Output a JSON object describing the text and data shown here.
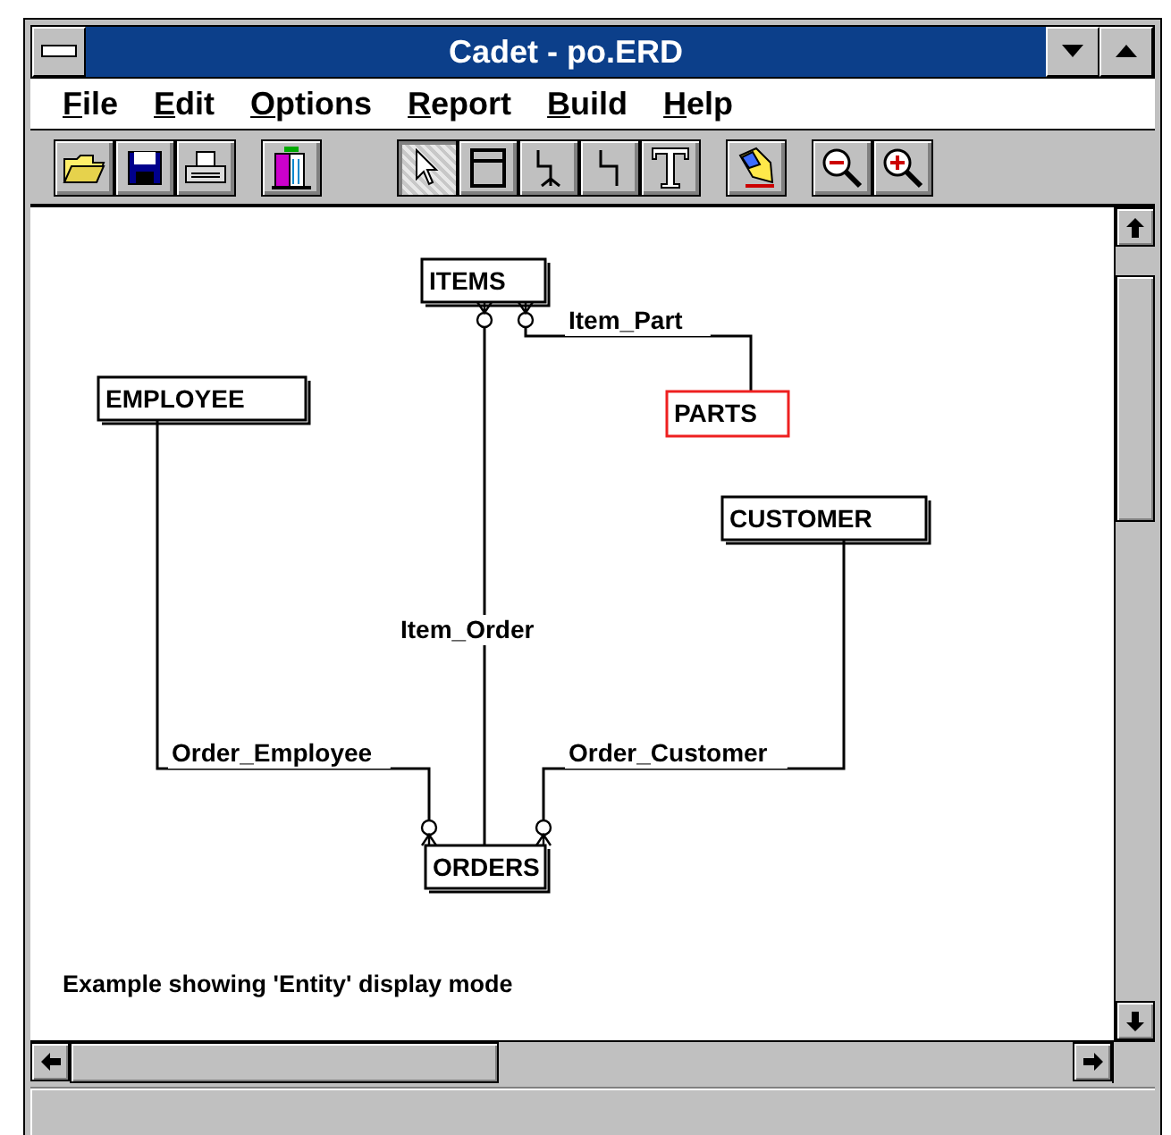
{
  "window": {
    "title": "Cadet - po.ERD"
  },
  "menu": [
    {
      "key": "F",
      "rest": "ile"
    },
    {
      "key": "E",
      "rest": "dit"
    },
    {
      "key": "O",
      "rest": "ptions"
    },
    {
      "key": "R",
      "rest": "eport"
    },
    {
      "key": "B",
      "rest": "uild"
    },
    {
      "key": "H",
      "rest": "elp"
    }
  ],
  "toolbar": [
    {
      "tools": [
        {
          "kind": "open"
        },
        {
          "kind": "save"
        },
        {
          "kind": "print"
        }
      ]
    },
    {
      "tools": [
        {
          "kind": "build"
        }
      ]
    },
    {
      "tools": [
        {
          "kind": "select",
          "selected": true
        },
        {
          "kind": "entity",
          "selected": false
        },
        {
          "kind": "branch",
          "selected": false
        },
        {
          "kind": "relation",
          "selected": false
        },
        {
          "kind": "text",
          "selected": false
        }
      ]
    },
    {
      "tools": [
        {
          "kind": "paint"
        }
      ]
    },
    {
      "tools": [
        {
          "kind": "zoom-out"
        },
        {
          "kind": "zoom-in"
        }
      ]
    }
  ],
  "entities": [
    {
      "name": "ITEMS",
      "selected": false
    },
    {
      "name": "PARTS",
      "selected": true
    },
    {
      "name": "EMPLOYEE",
      "selected": false
    },
    {
      "name": "CUSTOMER",
      "selected": false
    },
    {
      "name": "ORDERS",
      "selected": false
    }
  ],
  "relationships": [
    {
      "name": "Item_Part"
    },
    {
      "name": "Item_Order"
    },
    {
      "name": "Order_Employee"
    },
    {
      "name": "Order_Customer"
    }
  ],
  "caption": "Example showing 'Entity' display mode"
}
